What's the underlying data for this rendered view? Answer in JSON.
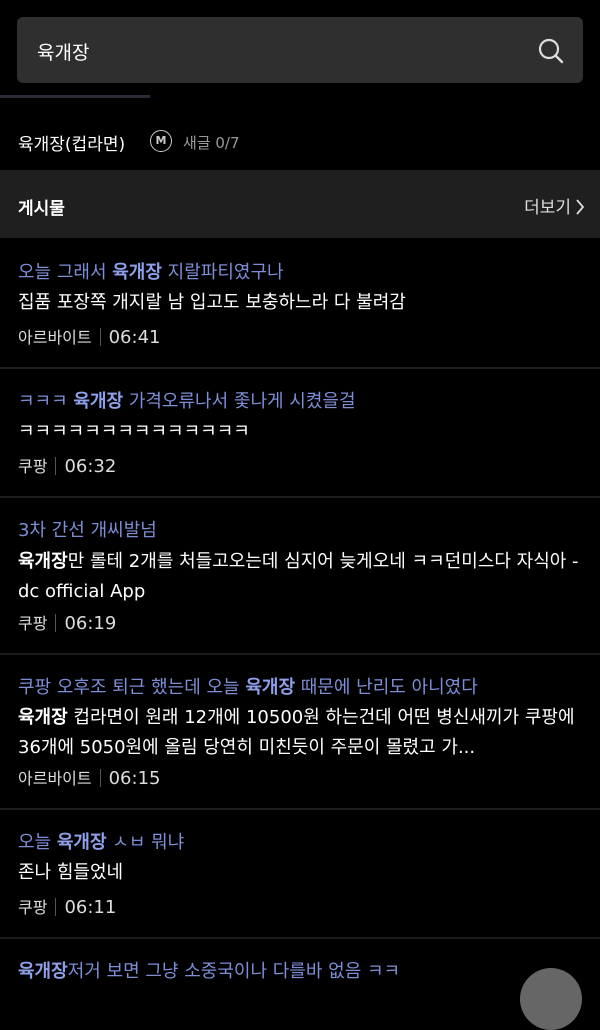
{
  "search": {
    "query": "육개장"
  },
  "dictionary": {
    "title": "육개장(컵라면)",
    "badge": "M",
    "subtitle": "새글 0/7"
  },
  "section": {
    "title": "게시물",
    "more_label": "더보기",
    "more_icon": "chevron-right-icon"
  },
  "posts": [
    {
      "title_pre": "오늘 그래서 ",
      "title_kw": "육개장",
      "title_post": " 지랄파티였구나",
      "body_kw": "",
      "body_rest": "집품 포장쪽 개지랄 남 입고도 보충하느라 다 불려감",
      "category": "아르바이트",
      "time": "06:41"
    },
    {
      "title_pre": "ㅋㅋㅋ ",
      "title_kw": "육개장",
      "title_post": " 가격오류나서 좇나게 시켰을걸",
      "body_kw": "",
      "body_rest": "ㅋㅋㅋㅋㅋㅋㅋㅋㅋㅋㅋㅋㅋㅋ",
      "category": "쿠팡",
      "time": "06:32"
    },
    {
      "title_pre": "3차 간선 개씨발넘",
      "title_kw": "",
      "title_post": "",
      "body_kw": "육개장",
      "body_rest": "만 롤테 2개를 처들고오는데 심지어 늦게오네 ㅋㅋ던미스다 자식아 - dc official App",
      "category": "쿠팡",
      "time": "06:19"
    },
    {
      "title_pre": "쿠팡 오후조 퇴근 했는데 오늘 ",
      "title_kw": "육개장",
      "title_post": " 때문에 난리도 아니였다",
      "body_kw": "육개장",
      "body_rest": " 컵라면이 원래 12개에 10500원 하는건데 어떤 병신새끼가 쿠팡에 36개에 5050원에 올림 당연히 미친듯이 주문이 몰렸고 가...",
      "category": "아르바이트",
      "time": "06:15"
    },
    {
      "title_pre": "오늘 ",
      "title_kw": "육개장",
      "title_post": " ㅅㅂ 뭐냐",
      "body_kw": "",
      "body_rest": "존나 힘들었네",
      "category": "쿠팡",
      "time": "06:11"
    },
    {
      "title_pre": "",
      "title_kw": "육개장",
      "title_post": "저거 보면 그냥 소중국이나 다를바 없음 ㅋㅋ",
      "body_kw": "",
      "body_rest": "",
      "category": "",
      "time": ""
    }
  ]
}
